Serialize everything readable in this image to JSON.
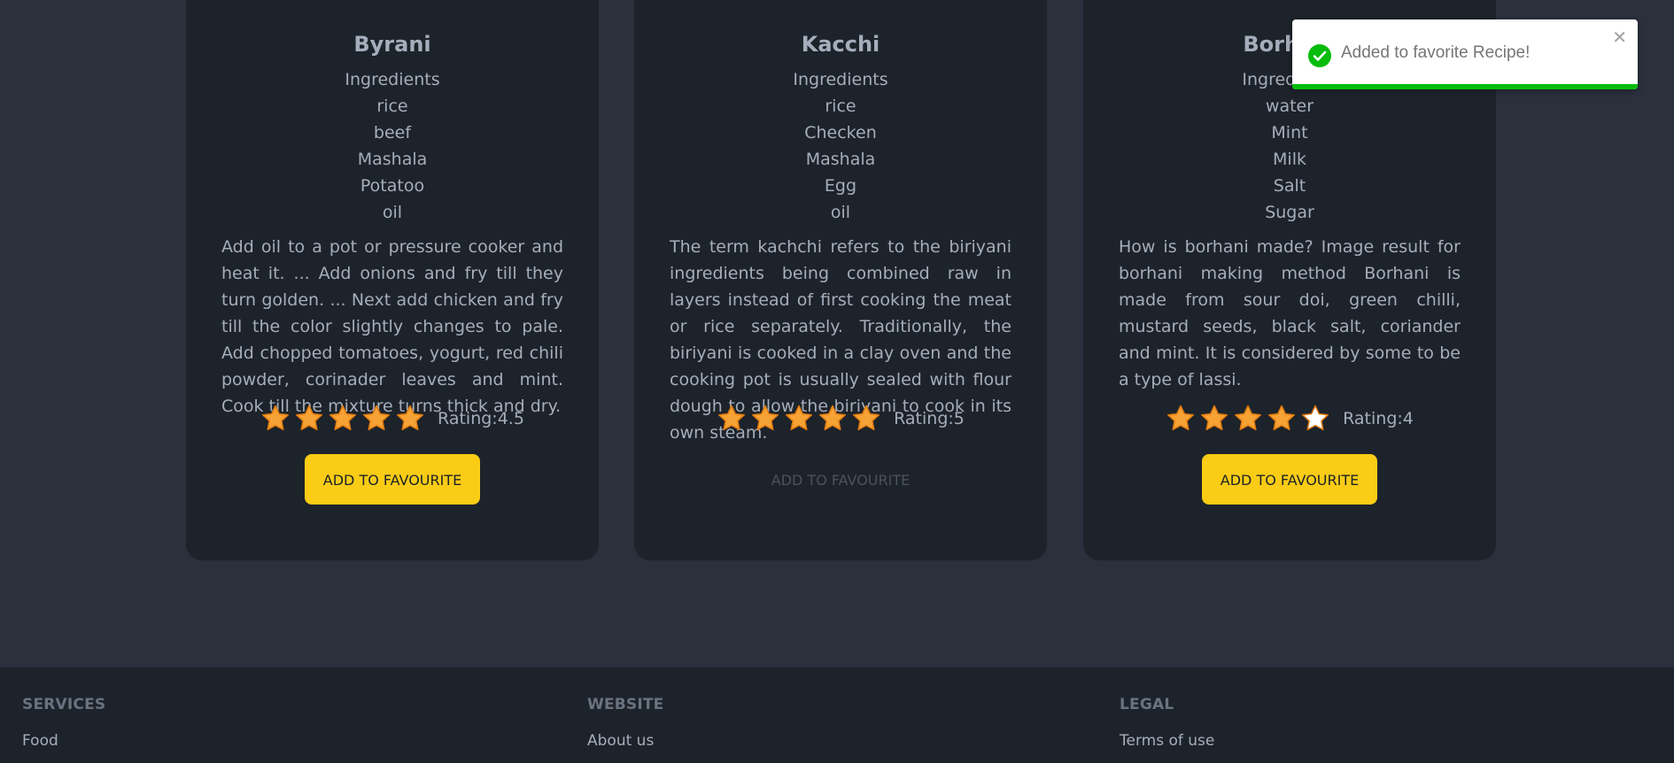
{
  "cards": [
    {
      "title": "Byrani",
      "ingredients_heading": "Ingredients",
      "ingredients": [
        "rice",
        "beef",
        "Mashala",
        "Potatoo",
        "oil"
      ],
      "description": "Add oil to a pot or pressure cooker and heat it. ... Add onions and fry till they turn golden. ... Next add chicken and fry till the color slightly changes to pale. Add chopped tomatoes, yogurt, red chili powder, corinader leaves and mint. Cook till the mixture turns thick and dry.",
      "rating": 4.5,
      "rating_label": "Rating:4.5",
      "filled_stars": 5,
      "button_label": "ADD TO FAVOURITE",
      "button_disabled": false
    },
    {
      "title": "Kacchi",
      "ingredients_heading": "Ingredients",
      "ingredients": [
        "rice",
        "Checken",
        "Mashala",
        "Egg",
        "oil"
      ],
      "description": "The term kachchi refers to the biriyani ingredients being combined raw in layers instead of first cooking the meat or rice separately. Traditionally, the biriyani is cooked in a clay oven and the cooking pot is usually sealed with flour dough to allow the biriyani to cook in its own steam.",
      "rating": 5,
      "rating_label": "Rating:5",
      "filled_stars": 5,
      "button_label": "ADD TO FAVOURITE",
      "button_disabled": true
    },
    {
      "title": "Borhani",
      "ingredients_heading": "Ingredients",
      "ingredients": [
        "water",
        "Mint",
        "Milk",
        "Salt",
        "Sugar"
      ],
      "description": "How is borhani made? Image result for borhani making method Borhani is made from sour doi, green chilli, mustard seeds, black salt, coriander and mint. It is considered by some to be a type of lassi.",
      "rating": 4,
      "rating_label": "Rating:4",
      "filled_stars": 4,
      "button_label": "ADD TO FAVOURITE",
      "button_disabled": false
    }
  ],
  "footer": {
    "services": {
      "heading": "SERVICES",
      "link": "Food"
    },
    "website": {
      "heading": "WEBSITE",
      "link": "About us"
    },
    "legal": {
      "heading": "LEGAL",
      "link": "Terms of use"
    }
  },
  "toast": {
    "message": "Added to favorite Recipe!",
    "close_icon": "close-icon",
    "status_icon": "check-circle-icon",
    "progress_remaining": 1.0
  },
  "colors": {
    "page_bg": "#2a303c",
    "card_bg": "#1d232a",
    "button_bg": "#facc15",
    "star_fill": "#f7a234",
    "star_empty": "#ffffff",
    "toast_success": "#07bc0c"
  }
}
